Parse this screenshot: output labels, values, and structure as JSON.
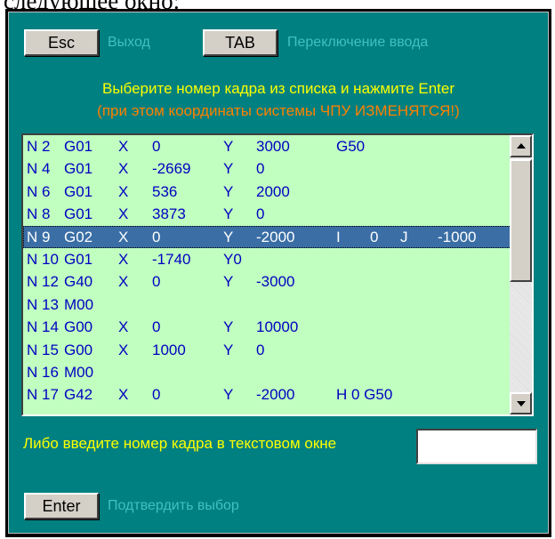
{
  "document_text": "следующее окно:",
  "header": {
    "esc_label": "Esc",
    "esc_hint": "Выход",
    "tab_label": "TAB",
    "tab_hint": "Переключение ввода"
  },
  "instructions": {
    "line1": "Выберите номер кадра из списка и нажмите Enter",
    "line2": "(при этом координаты системы ЧПУ ИЗМЕНЯТСЯ!)"
  },
  "frame_list": {
    "selected_index": 4,
    "rows": [
      [
        "N 2",
        "G01",
        "X",
        "0",
        "Y",
        "3000",
        "G50",
        "",
        "",
        ""
      ],
      [
        "N 4",
        "G01",
        "X",
        "-2669",
        "Y",
        "0",
        "",
        "",
        "",
        ""
      ],
      [
        "N 6",
        "G01",
        "X",
        "536",
        "Y",
        "2000",
        "",
        "",
        "",
        ""
      ],
      [
        "N 8",
        "G01",
        "X",
        "3873",
        "Y",
        "0",
        "",
        "",
        "",
        ""
      ],
      [
        "N 9",
        "G02",
        "X",
        "0",
        "Y",
        "-2000",
        "I",
        "0",
        "J",
        "-1000"
      ],
      [
        "N 10",
        "G01",
        "X",
        "-1740",
        "Y0",
        "",
        "",
        "",
        "",
        ""
      ],
      [
        "N 12",
        "G40",
        "X",
        "0",
        "Y",
        "-3000",
        "",
        "",
        "",
        ""
      ],
      [
        "N 13",
        "M00",
        "",
        "",
        "",
        "",
        "",
        "",
        "",
        ""
      ],
      [
        "N 14",
        "G00",
        "X",
        "0",
        "Y",
        "10000",
        "",
        "",
        "",
        ""
      ],
      [
        "N 15",
        "G00",
        "X",
        "1000",
        "Y",
        "0",
        "",
        "",
        "",
        ""
      ],
      [
        "N 16",
        "M00",
        "",
        "",
        "",
        "",
        "",
        "",
        "",
        ""
      ],
      [
        "N 17",
        "G42",
        "X",
        "0",
        "Y",
        "-2000",
        "H 0 G50",
        "",
        "",
        ""
      ]
    ]
  },
  "manual_entry": {
    "prompt": "Либо введите номер кадра в текстовом окне",
    "value": ""
  },
  "footer": {
    "enter_label": "Enter",
    "enter_hint": "Подтвердить выбор"
  },
  "colors": {
    "panel_bg": "#008080",
    "list_bg": "#c0ffc0",
    "list_text": "#0000c0",
    "selection_bg": "#3a6ea5",
    "instruction_yellow": "#ffff00",
    "warning_orange": "#ff8000",
    "hint_cyan": "#40c0c0"
  }
}
